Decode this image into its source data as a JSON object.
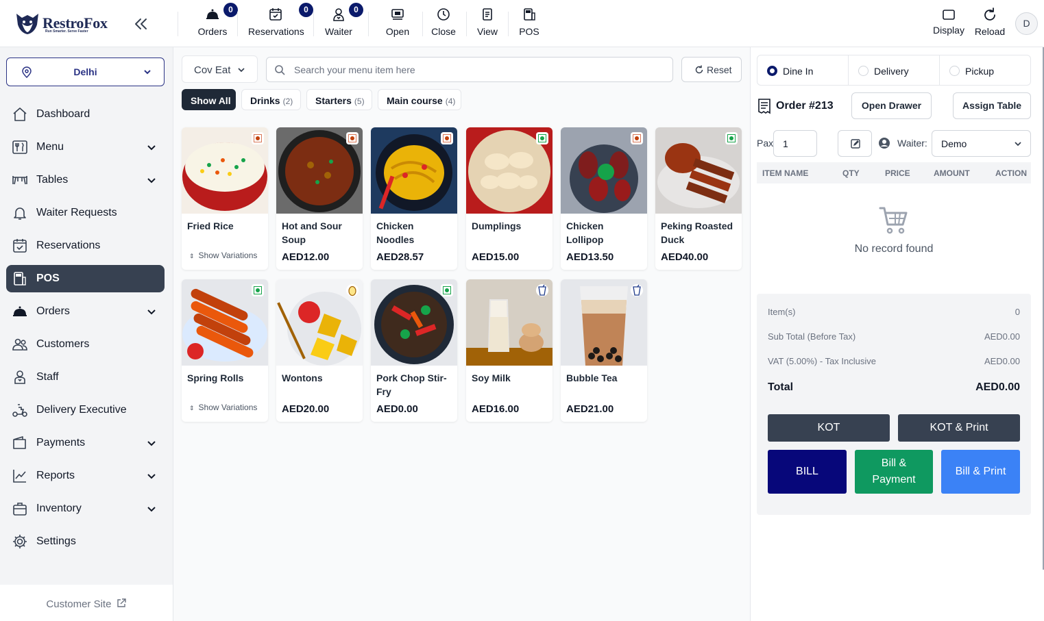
{
  "brand": {
    "name": "RestroFox",
    "tagline": "Run Smarter. Serve Faster"
  },
  "topbar": {
    "items": [
      {
        "label": "Orders",
        "badge": "0"
      },
      {
        "label": "Reservations",
        "badge": "0"
      },
      {
        "label": "Waiter",
        "badge": "0"
      },
      {
        "label": "Open"
      },
      {
        "label": "Close"
      },
      {
        "label": "View"
      },
      {
        "label": "POS"
      }
    ],
    "right": [
      {
        "label": "Display"
      },
      {
        "label": "Reload"
      }
    ],
    "avatar": "D"
  },
  "sidebar": {
    "location": "Delhi",
    "items": [
      {
        "label": "Dashboard",
        "icon": "home-icon"
      },
      {
        "label": "Menu",
        "icon": "utensils-icon",
        "expandable": true
      },
      {
        "label": "Tables",
        "icon": "table-icon",
        "expandable": true
      },
      {
        "label": "Waiter Requests",
        "icon": "bell-icon"
      },
      {
        "label": "Reservations",
        "icon": "calendar-check-icon"
      },
      {
        "label": "POS",
        "icon": "pos-icon",
        "active": true
      },
      {
        "label": "Orders",
        "icon": "cloche-icon",
        "expandable": true
      },
      {
        "label": "Customers",
        "icon": "users-icon"
      },
      {
        "label": "Staff",
        "icon": "staff-icon"
      },
      {
        "label": "Delivery Executive",
        "icon": "scooter-icon"
      },
      {
        "label": "Payments",
        "icon": "wallet-icon",
        "expandable": true
      },
      {
        "label": "Reports",
        "icon": "chart-line-icon",
        "expandable": true
      },
      {
        "label": "Inventory",
        "icon": "briefcase-icon",
        "expandable": true
      },
      {
        "label": "Settings",
        "icon": "gear-icon"
      }
    ],
    "customer_site": "Customer Site"
  },
  "menu": {
    "category_select": "Cov Eat",
    "search_placeholder": "Search your menu item here",
    "reset_label": "Reset",
    "filters": [
      {
        "label": "Show All",
        "active": true
      },
      {
        "label": "Drinks",
        "count": "(2)"
      },
      {
        "label": "Starters",
        "count": "(5)"
      },
      {
        "label": "Main course",
        "count": "(4)"
      }
    ],
    "items": [
      {
        "name": "Fried Rice",
        "variation": "Show Variations",
        "diet": "nonveg"
      },
      {
        "name": "Hot and Sour Soup",
        "price": "AED12.00",
        "diet": "nonveg"
      },
      {
        "name": "Chicken Noodles",
        "price": "AED28.57",
        "diet": "nonveg"
      },
      {
        "name": "Dumplings",
        "price": "AED15.00",
        "diet": "veg"
      },
      {
        "name": "Chicken Lollipop",
        "price": "AED13.50",
        "diet": "nonveg"
      },
      {
        "name": "Peking Roasted Duck",
        "price": "AED40.00",
        "diet": "veg"
      },
      {
        "name": "Spring Rolls",
        "variation": "Show Variations",
        "diet": "veg"
      },
      {
        "name": "Wontons",
        "price": "AED20.00",
        "diet": "egg"
      },
      {
        "name": "Pork Chop Stir-Fry",
        "price": "AED0.00",
        "diet": "veg"
      },
      {
        "name": "Soy Milk",
        "price": "AED16.00",
        "diet": "beverage"
      },
      {
        "name": "Bubble Tea",
        "price": "AED21.00",
        "diet": "beverage"
      }
    ]
  },
  "order": {
    "types": [
      {
        "label": "Dine In",
        "selected": true
      },
      {
        "label": "Delivery"
      },
      {
        "label": "Pickup"
      }
    ],
    "title": "Order #213",
    "open_drawer": "Open Drawer",
    "assign_table": "Assign Table",
    "pax_label": "Pax",
    "pax_value": "1",
    "waiter_label": "Waiter:",
    "waiter_value": "Demo",
    "columns": [
      "ITEM NAME",
      "QTY",
      "PRICE",
      "AMOUNT",
      "ACTION"
    ],
    "empty_text": "No record found",
    "summary": {
      "items_label": "Item(s)",
      "items_value": "0",
      "subtotal_label": "Sub Total (Before Tax)",
      "subtotal_value": "AED0.00",
      "vat_label": "VAT (5.00%) - Tax Inclusive",
      "vat_value": "AED0.00",
      "total_label": "Total",
      "total_value": "AED0.00"
    },
    "actions": {
      "kot": "KOT",
      "kot_print": "KOT & Print",
      "bill": "BILL",
      "bill_payment": "Bill & Payment",
      "bill_print": "Bill & Print"
    },
    "colors": {
      "bill": "#07077a",
      "bill_payment": "#0f9960",
      "bill_print": "#3b82f6",
      "kot": "#374151"
    }
  }
}
